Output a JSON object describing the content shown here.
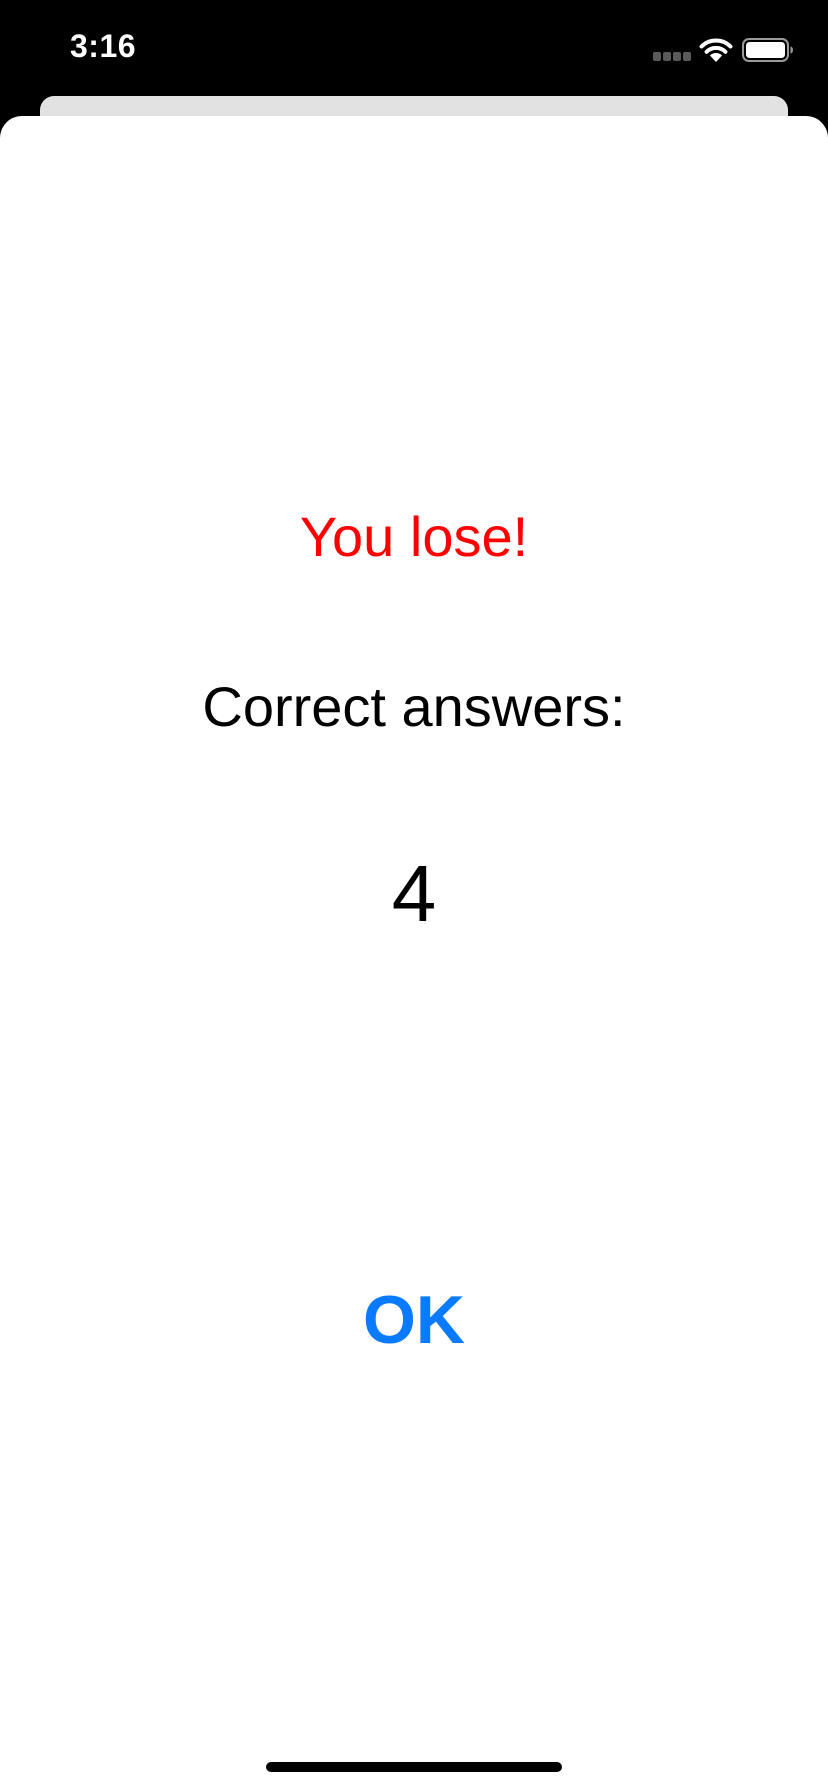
{
  "status_bar": {
    "time": "3:16",
    "icons": [
      "signal-icon",
      "wifi-icon",
      "battery-icon"
    ]
  },
  "result": {
    "title": "You lose!",
    "answers_label": "Correct answers:",
    "score": "4"
  },
  "actions": {
    "ok_label": "OK"
  },
  "colors": {
    "lose": "#ff0000",
    "accent": "#0a7aff",
    "background": "#000000",
    "sheet": "#ffffff"
  }
}
